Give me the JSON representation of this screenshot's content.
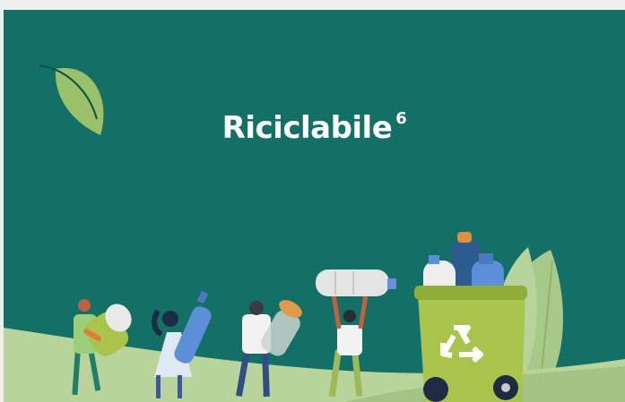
{
  "banner": {
    "title": "Riciclabile",
    "title_superscript": "6",
    "background_color": "#137066",
    "ground_color": "#b9d49a",
    "leaf_color": "#9bc06a",
    "bin_color": "#a8c44a",
    "icons": [
      "leaf-icon",
      "recycle-icon",
      "recycling-bin",
      "plastic-bottle",
      "glass-jar"
    ]
  }
}
